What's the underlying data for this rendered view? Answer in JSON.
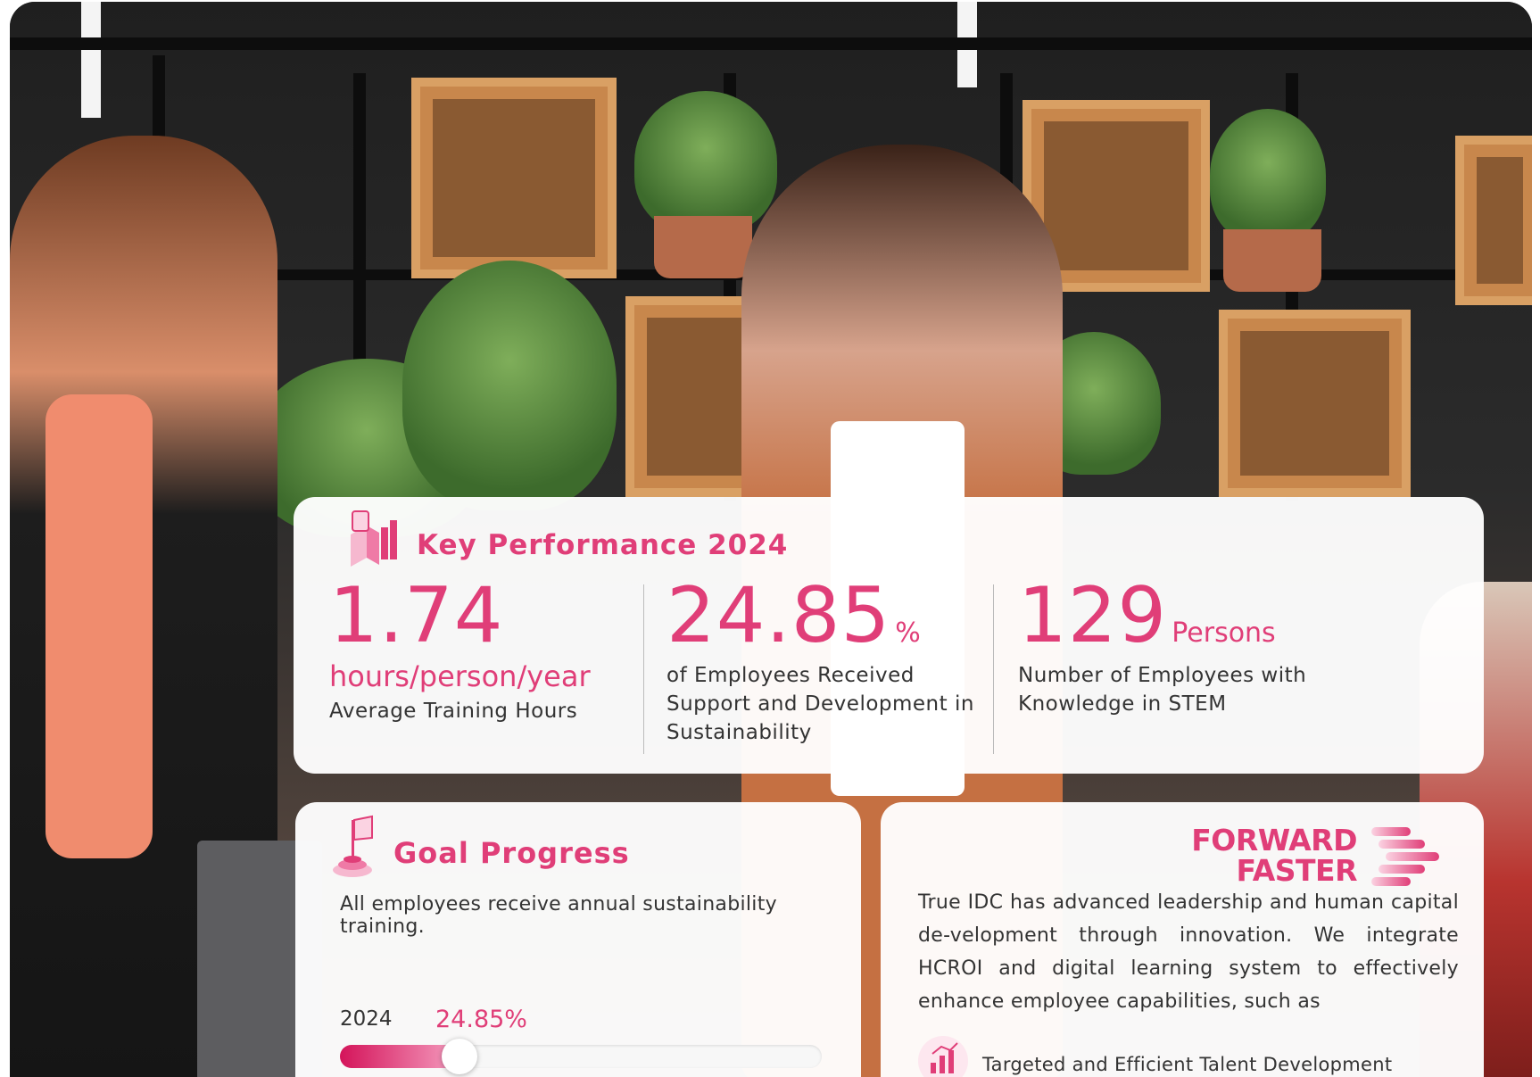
{
  "colors": {
    "accent": "#e03e78",
    "text": "#333333"
  },
  "key_performance": {
    "title": "Key Performance 2024",
    "icon": "bar-chart-icon",
    "metrics": [
      {
        "value": "1.74",
        "unit": "hours/person/year",
        "description": "Average Training Hours"
      },
      {
        "value": "24.85",
        "unit": "%",
        "description_lines": [
          "of Employees Received",
          "Support and Development in",
          "Sustainability"
        ]
      },
      {
        "value": "129",
        "unit": "Persons",
        "description_lines": [
          "Number of Employees with",
          "Knowledge in STEM"
        ]
      }
    ]
  },
  "goal_progress": {
    "title": "Goal Progress",
    "icon": "flag-target-icon",
    "text": "All employees receive annual sustainability training.",
    "year": "2024",
    "percent_label": "24.85%",
    "progress_fraction": 0.2485
  },
  "forward_faster": {
    "logo_line1": "FORWARD",
    "logo_line2": "FASTER",
    "text": "True IDC has advanced leadership and human capital de-velopment through innovation. We integrate HCROI and digital learning system to effectively enhance employee capabilities, such as",
    "item_icon": "talent-development-icon",
    "item": "Targeted and Efficient Talent Development"
  }
}
